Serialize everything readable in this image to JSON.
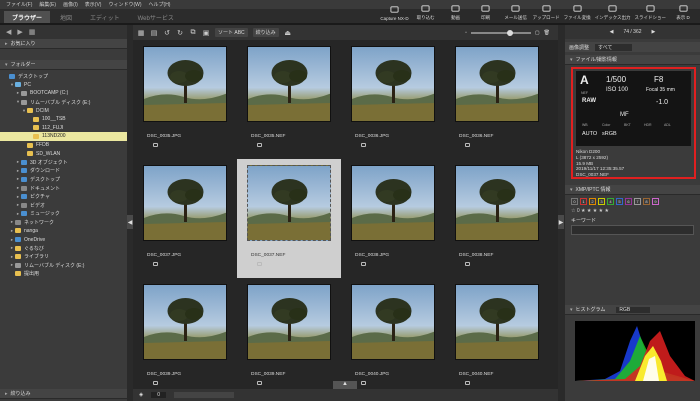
{
  "menu": [
    "ファイル(F)",
    "編集(E)",
    "画像(I)",
    "表示(V)",
    "ウィンドウ(W)",
    "ヘルプ(H)"
  ],
  "tabs": [
    {
      "label": "ブラウザー",
      "active": true
    },
    {
      "label": "地図",
      "active": false
    },
    {
      "label": "エディット",
      "active": false
    },
    {
      "label": "Webサービス",
      "active": false
    }
  ],
  "toolbar": [
    "Capture NX-D",
    "取り込む",
    "動画",
    "印刷",
    "メール送信",
    "アップロード",
    "ファイル変換",
    "インデックス出力",
    "スライドショー",
    "表示 D"
  ],
  "left": {
    "favorites": "お気に入り",
    "folders": "フォルダー",
    "tree": [
      {
        "label": "デスクトップ",
        "indent": 0,
        "tw": "",
        "icon": "blue",
        "sel": false
      },
      {
        "label": "PC",
        "indent": 1,
        "tw": "▾",
        "icon": "pc",
        "sel": false
      },
      {
        "label": "BOOTCAMP (C:)",
        "indent": 2,
        "tw": "▸",
        "icon": "drive",
        "sel": false
      },
      {
        "label": "リムーバブル ディスク (E:)",
        "indent": 2,
        "tw": "▾",
        "icon": "drive",
        "sel": false
      },
      {
        "label": "DCIM",
        "indent": 3,
        "tw": "▾",
        "icon": "fold",
        "sel": false
      },
      {
        "label": "100__TSB",
        "indent": 4,
        "tw": "",
        "icon": "fold",
        "sel": false
      },
      {
        "label": "112_FUJI",
        "indent": 4,
        "tw": "",
        "icon": "fold",
        "sel": false
      },
      {
        "label": "113ND200",
        "indent": 4,
        "tw": "",
        "icon": "fold",
        "sel": true
      },
      {
        "label": "FFDB",
        "indent": 3,
        "tw": "",
        "icon": "fold",
        "sel": false
      },
      {
        "label": "SD_WLAN",
        "indent": 3,
        "tw": "",
        "icon": "fold",
        "sel": false
      },
      {
        "label": "3D オブジェクト",
        "indent": 2,
        "tw": "▸",
        "icon": "blue",
        "sel": false
      },
      {
        "label": "ダウンロード",
        "indent": 2,
        "tw": "▸",
        "icon": "blue",
        "sel": false
      },
      {
        "label": "デスクトップ",
        "indent": 2,
        "tw": "▸",
        "icon": "blue",
        "sel": false
      },
      {
        "label": "ドキュメント",
        "indent": 2,
        "tw": "▸",
        "icon": "dark",
        "sel": false
      },
      {
        "label": "ピクチャ",
        "indent": 2,
        "tw": "▸",
        "icon": "blue",
        "sel": false
      },
      {
        "label": "ビデオ",
        "indent": 2,
        "tw": "▸",
        "icon": "dark",
        "sel": false
      },
      {
        "label": "ミュージック",
        "indent": 2,
        "tw": "▸",
        "icon": "blue",
        "sel": false
      },
      {
        "label": "ネットワーク",
        "indent": 1,
        "tw": "▸",
        "icon": "dark",
        "sel": false
      },
      {
        "label": "nanga",
        "indent": 1,
        "tw": "▸",
        "icon": "fold",
        "sel": false
      },
      {
        "label": "OneDrive",
        "indent": 1,
        "tw": "▸",
        "icon": "blue",
        "sel": false
      },
      {
        "label": "ぐるなび",
        "indent": 1,
        "tw": "▸",
        "icon": "fold",
        "sel": false
      },
      {
        "label": "ライブラリ",
        "indent": 1,
        "tw": "▸",
        "icon": "fold",
        "sel": false
      },
      {
        "label": "リムーバブル ディスク (E:)",
        "indent": 1,
        "tw": "▸",
        "icon": "drive",
        "sel": false
      },
      {
        "label": "提出用",
        "indent": 1,
        "tw": "",
        "icon": "fold",
        "sel": false
      }
    ],
    "filter": "絞り込み"
  },
  "center": {
    "sort": "ソート ABC",
    "filter": "絞り込み",
    "count": "0",
    "files": [
      "DSC_0035.JPG",
      "DSC_0035.NEF",
      "DSC_0036.JPG",
      "DSC_0036.NEF",
      "DSC_0037.JPG",
      "DSC_0037.NEF",
      "DSC_0038.JPG",
      "DSC_0038.NEF",
      "DSC_0039.JPG",
      "DSC_0039.NEF",
      "DSC_0040.JPG",
      "DSC_0040.NEF"
    ],
    "selected_index": 5
  },
  "right": {
    "nav": "74 / 362",
    "adjust_label": "画像調整",
    "adjust_value": "すべて",
    "file_info_label": "ファイル/撮影情報",
    "mode": "A",
    "shutter": "1/500",
    "fnum": "F8",
    "iso": "ISO 100",
    "focal": "Focal 35 mm",
    "quality": "RAW",
    "ev": "-1.0",
    "focus": "MF",
    "wb": "AUTO",
    "colorspace": "sRGB",
    "lcd_small": [
      "NEF",
      "WB",
      "Color",
      "BKT",
      "HDR",
      "ADL"
    ],
    "meta": [
      "Nikon D200",
      "L (3872 x 2592)",
      "15.9 MB",
      "2019/11/17 12:35:35.57",
      "DSC_0037.NEF"
    ],
    "xmp_label": "XMP/IPTC 情報",
    "rating": "☆ 0 ★ ★ ★ ★ ★",
    "keyword_label": "キーワード",
    "histogram_label": "ヒストグラム",
    "histogram_mode": "RGB"
  }
}
